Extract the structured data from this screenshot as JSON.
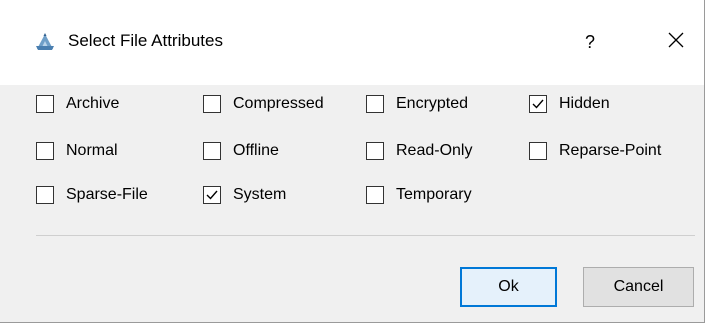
{
  "window": {
    "title": "Select File Attributes",
    "help_label": "?",
    "close_icon": "close-icon",
    "app_icon": "app-icon"
  },
  "attributes": [
    {
      "label": "Archive",
      "checked": false
    },
    {
      "label": "Compressed",
      "checked": false
    },
    {
      "label": "Encrypted",
      "checked": false
    },
    {
      "label": "Hidden",
      "checked": true
    },
    {
      "label": "Normal",
      "checked": false
    },
    {
      "label": "Offline",
      "checked": false
    },
    {
      "label": "Read-Only",
      "checked": false
    },
    {
      "label": "Reparse-Point",
      "checked": false
    },
    {
      "label": "Sparse-File",
      "checked": false
    },
    {
      "label": "System",
      "checked": true
    },
    {
      "label": "Temporary",
      "checked": false
    }
  ],
  "buttons": {
    "ok_label": "Ok",
    "cancel_label": "Cancel"
  },
  "colors": {
    "accent": "#0078d7"
  }
}
